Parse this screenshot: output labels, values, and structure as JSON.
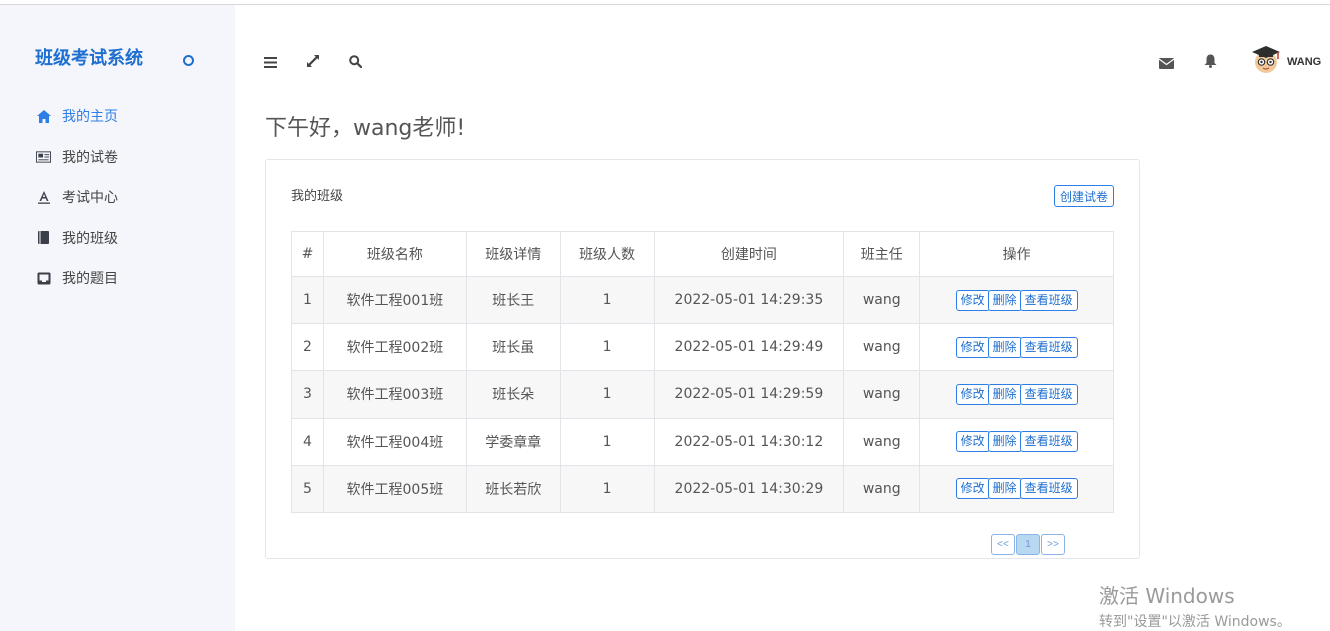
{
  "app": {
    "brand": "班级考试系统"
  },
  "sidebar": {
    "items": [
      {
        "label": "我的主页",
        "icon": "home-icon",
        "active": true
      },
      {
        "label": "我的试卷",
        "icon": "newspaper-icon",
        "active": false
      },
      {
        "label": "考试中心",
        "icon": "font-icon",
        "active": false
      },
      {
        "label": "我的班级",
        "icon": "book-icon",
        "active": false
      },
      {
        "label": "我的题目",
        "icon": "inbox-icon",
        "active": false
      }
    ]
  },
  "header": {
    "icons": [
      "menu-icon",
      "fullscreen-icon",
      "search-icon",
      "mail-icon",
      "bell-icon"
    ],
    "user": {
      "name": "WANG"
    }
  },
  "greeting": "下午好，wang老师!",
  "card": {
    "title": "我的班级",
    "create_label": "创建试卷",
    "columns": [
      "#",
      "班级名称",
      "班级详情",
      "班级人数",
      "创建时间",
      "班主任",
      "操作"
    ],
    "rows": [
      {
        "no": "1",
        "name": "软件工程001班",
        "detail": "班长王",
        "count": "1",
        "created": "2022-05-01 14:29:35",
        "teacher": "wang"
      },
      {
        "no": "2",
        "name": "软件工程002班",
        "detail": "班长虽",
        "count": "1",
        "created": "2022-05-01 14:29:49",
        "teacher": "wang"
      },
      {
        "no": "3",
        "name": "软件工程003班",
        "detail": "班长朵",
        "count": "1",
        "created": "2022-05-01 14:29:59",
        "teacher": "wang"
      },
      {
        "no": "4",
        "name": "软件工程004班",
        "detail": "学委章章",
        "count": "1",
        "created": "2022-05-01 14:30:12",
        "teacher": "wang"
      },
      {
        "no": "5",
        "name": "软件工程005班",
        "detail": "班长若欣",
        "count": "1",
        "created": "2022-05-01 14:30:29",
        "teacher": "wang"
      }
    ],
    "actions": {
      "edit": "修改",
      "delete": "删除",
      "view": "查看班级"
    },
    "pager": {
      "prev": "<<",
      "current": "1",
      "next": ">>"
    }
  },
  "watermark": {
    "line1": "激活 Windows",
    "line2": "转到\"设置\"以激活 Windows。"
  },
  "colors": {
    "accent": "#1e6fd0",
    "sidebar_bg": "#f4f6fb"
  }
}
